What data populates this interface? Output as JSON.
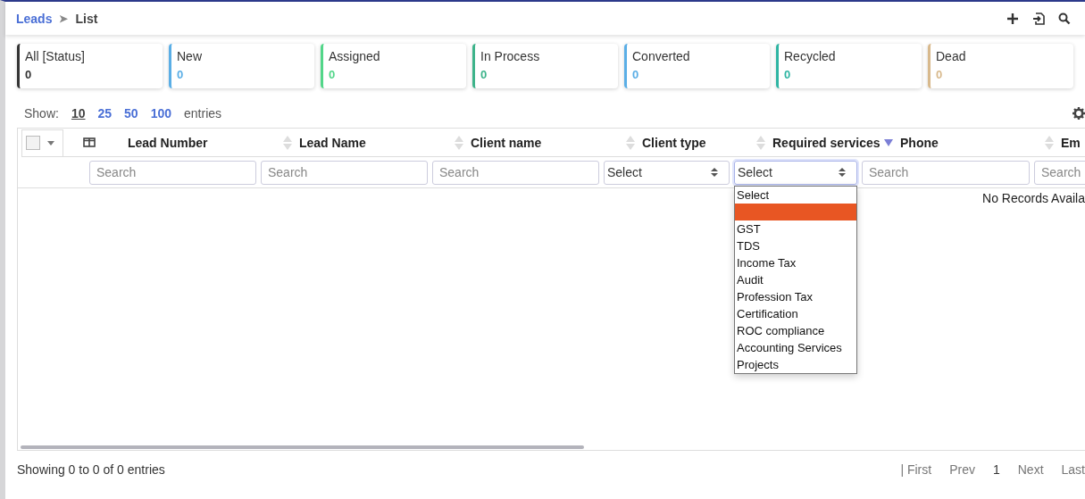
{
  "breadcrumb": {
    "parent": "Leads",
    "separator": "➤",
    "current": "List"
  },
  "toolbar": {
    "actions": [
      {
        "kind": "add"
      },
      {
        "kind": "import"
      },
      {
        "kind": "search"
      }
    ]
  },
  "status_cards": [
    {
      "label": "All [Status]",
      "count": "0",
      "color": "#333333"
    },
    {
      "label": "New",
      "count": "0",
      "color": "#5aaee6"
    },
    {
      "label": "Assigned",
      "count": "0",
      "color": "#52d689"
    },
    {
      "label": "In Process",
      "count": "0",
      "color": "#3db38a"
    },
    {
      "label": "Converted",
      "count": "0",
      "color": "#5aaee6"
    },
    {
      "label": "Recycled",
      "count": "0",
      "color": "#2fb5a3"
    },
    {
      "label": "Dead",
      "count": "0",
      "color": "#d8b98c"
    }
  ],
  "page_length": {
    "label": "Show:",
    "options": [
      {
        "label": "10",
        "selected": true
      },
      {
        "label": "25",
        "selected": false
      },
      {
        "label": "50",
        "selected": false
      },
      {
        "label": "100",
        "selected": false
      }
    ],
    "suffix": "entries"
  },
  "table": {
    "select_all": {
      "checked": false
    },
    "columns": [
      {
        "label": "Lead Number",
        "filter": {
          "kind": "text",
          "placeholder": "Search"
        }
      },
      {
        "label": "Lead Name",
        "sorted": false,
        "filter": {
          "kind": "text",
          "placeholder": "Search"
        }
      },
      {
        "label": "Client name",
        "sorted": false,
        "filter": {
          "kind": "text",
          "placeholder": "Search"
        }
      },
      {
        "label": "Client type",
        "sorted": false,
        "filter": {
          "kind": "select",
          "value": "Select"
        }
      },
      {
        "label": "Required services",
        "sorted": false,
        "filter": {
          "kind": "select",
          "value": "Select",
          "expanded": true,
          "options": [
            {
              "label": "Select",
              "highlighted": false
            },
            {
              "highlighted": true
            },
            {
              "label": "GST",
              "highlighted": false
            },
            {
              "label": "TDS",
              "highlighted": false
            },
            {
              "label": "Income Tax",
              "highlighted": false
            },
            {
              "label": "Audit",
              "highlighted": false
            },
            {
              "label": "Profession Tax",
              "highlighted": false
            },
            {
              "label": "Certification",
              "highlighted": false
            },
            {
              "label": "ROC compliance",
              "highlighted": false
            },
            {
              "label": "Accounting Services",
              "highlighted": false
            },
            {
              "label": "Projects",
              "highlighted": false
            }
          ]
        }
      },
      {
        "label": "Phone",
        "sorted": true,
        "filter": {
          "kind": "text",
          "placeholder": "Search"
        }
      },
      {
        "label": "Em",
        "sorted": false,
        "filter": {
          "kind": "text",
          "placeholder": "Search"
        }
      }
    ],
    "empty_message": "No Records Availa"
  },
  "info": "Showing 0 to 0 of 0 entries",
  "pagination": [
    {
      "label": "| First",
      "selected": false
    },
    {
      "label": "Prev",
      "selected": false
    },
    {
      "label": "1",
      "selected": true
    },
    {
      "label": "Next",
      "selected": false
    },
    {
      "label": "Last",
      "selected": false
    }
  ]
}
